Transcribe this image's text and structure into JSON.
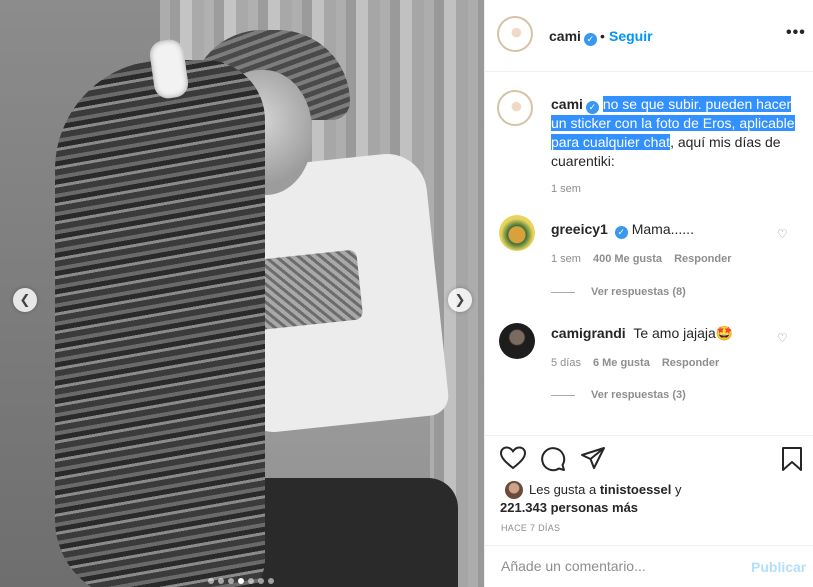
{
  "post": {
    "username": "cami",
    "follow_label": "Seguir",
    "separator": "•",
    "more": "•••",
    "slide_count": 7,
    "active_slide": 3
  },
  "caption": {
    "username": "cami",
    "selected_text": "no se que subir. pueden hacer un sticker con la foto de Eros, aplicable para cualquier chat",
    "rest_text": ", aquí mis días de cuarentiki:",
    "time": "1 sem"
  },
  "comments": [
    {
      "username": "greeicy1",
      "verified": true,
      "text": "Mama......",
      "time": "1 sem",
      "likes": "400 Me gusta",
      "reply_label": "Responder",
      "view_replies": "Ver respuestas (8)"
    },
    {
      "username": "camigrandi",
      "verified": false,
      "text": "Te amo jajaja🤩",
      "time": "5 días",
      "likes": "6 Me gusta",
      "reply_label": "Responder",
      "view_replies": "Ver respuestas (3)"
    }
  ],
  "likes": {
    "prefix": "Les gusta a",
    "liker": "tinistoessel",
    "conj": "y",
    "count": "221.343 personas más"
  },
  "date": "HACE 7 DÍAS",
  "add_comment": {
    "placeholder": "Añade un comentario...",
    "publish_label": "Publicar"
  },
  "colors": {
    "accent": "#0095f6",
    "selection": "#3390ff",
    "muted": "#8e8e8e"
  },
  "icons": [
    "chevron-left-icon",
    "chevron-right-icon",
    "verified-icon",
    "heart-icon",
    "comment-icon",
    "share-icon",
    "bookmark-icon"
  ]
}
